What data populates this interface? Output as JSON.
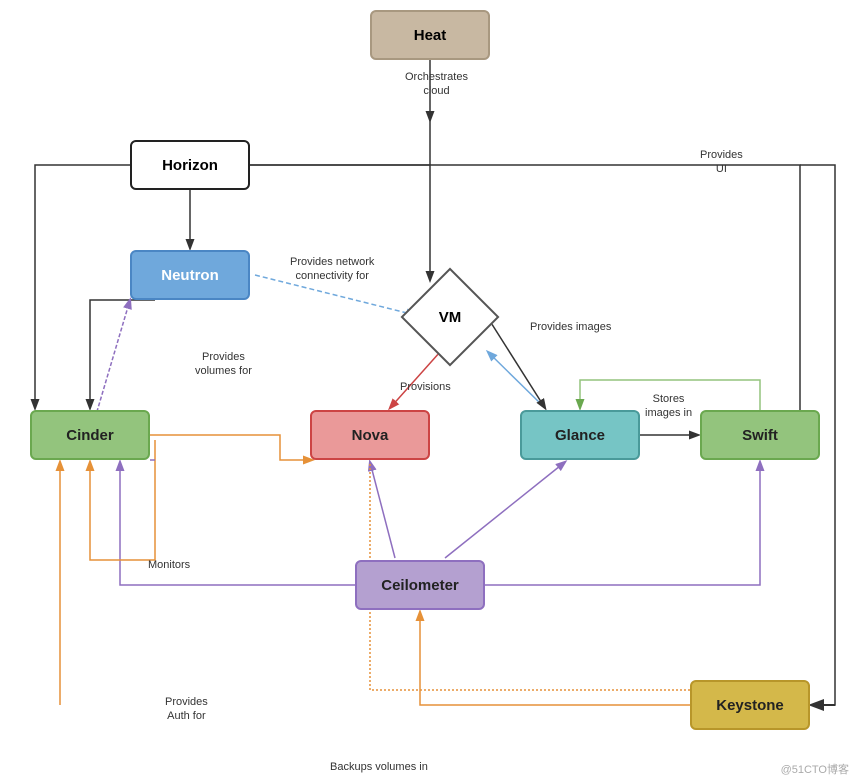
{
  "nodes": {
    "heat": {
      "label": "Heat"
    },
    "horizon": {
      "label": "Horizon"
    },
    "neutron": {
      "label": "Neutron"
    },
    "cinder": {
      "label": "Cinder"
    },
    "nova": {
      "label": "Nova"
    },
    "glance": {
      "label": "Glance"
    },
    "swift": {
      "label": "Swift"
    },
    "ceilometer": {
      "label": "Ceilometer"
    },
    "keystone": {
      "label": "Keystone"
    },
    "vm": {
      "label": "VM"
    }
  },
  "labels": {
    "orchestrates_cloud": "Orchestrates\ncloud",
    "provides_ui": "Provides\nUI",
    "provides_network": "Provides network\nconnectivity for",
    "provides_volumes": "Provides\nvolumes for",
    "provisions": "Provisions",
    "provides_images": "Provides images",
    "stores_images": "Stores\nimages in",
    "monitors": "Monitors",
    "provides_auth": "Provides\nAuth for",
    "backups_volumes": "Backups volumes in"
  },
  "watermark": "@51CTO博客"
}
